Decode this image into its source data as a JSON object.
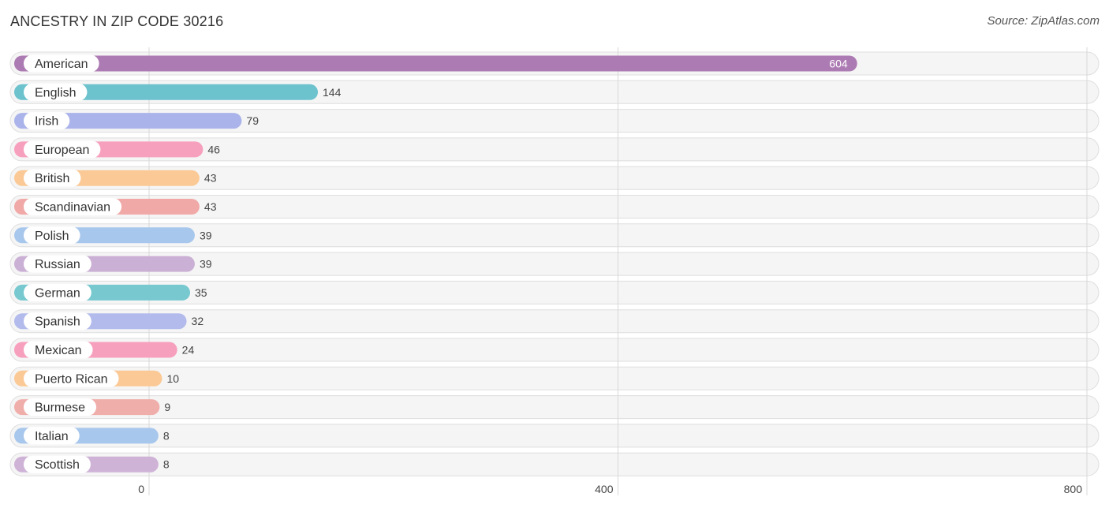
{
  "header": {
    "title": "ANCESTRY IN ZIP CODE 30216",
    "source": "Source: ZipAtlas.com"
  },
  "chart_data": {
    "type": "bar",
    "orientation": "horizontal",
    "title": "ANCESTRY IN ZIP CODE 30216",
    "xlabel": "",
    "ylabel": "",
    "xlim": [
      0,
      800
    ],
    "xticks": [
      0,
      400,
      800
    ],
    "grid": true,
    "categories": [
      "American",
      "English",
      "Irish",
      "European",
      "British",
      "Scandinavian",
      "Polish",
      "Russian",
      "German",
      "Spanish",
      "Mexican",
      "Puerto Rican",
      "Burmese",
      "Italian",
      "Scottish"
    ],
    "values": [
      604,
      144,
      79,
      46,
      43,
      43,
      39,
      39,
      35,
      32,
      24,
      10,
      9,
      8,
      8
    ],
    "colors": [
      "#ad7bb3",
      "#6cc2cd",
      "#aab4ea",
      "#f7a0bd",
      "#fbc995",
      "#f0a9a7",
      "#a8c7ec",
      "#cbb0d5",
      "#77c8cf",
      "#b3bbec",
      "#f7a0bd",
      "#fbc995",
      "#f0aeab",
      "#a8c7ec",
      "#cfb3d7"
    ]
  }
}
